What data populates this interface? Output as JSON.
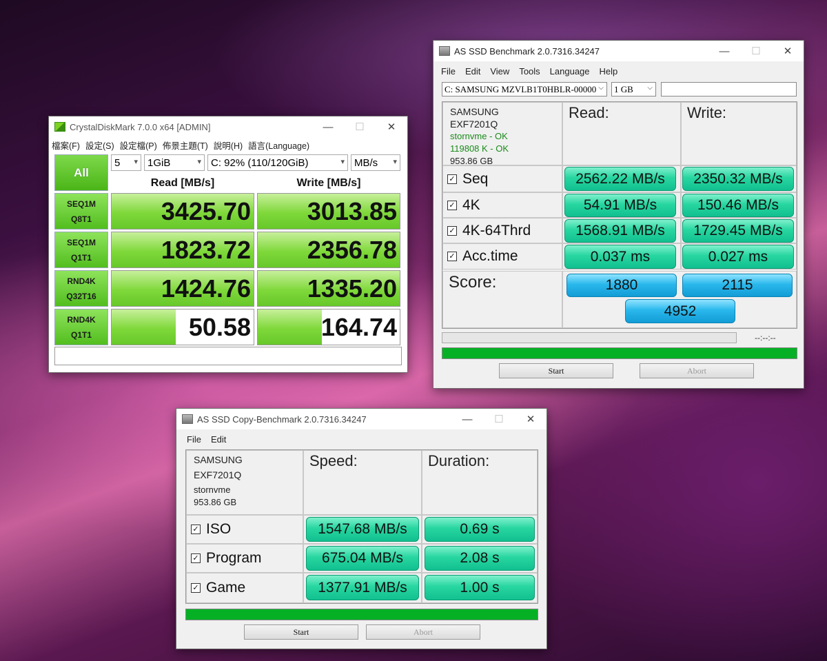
{
  "cdm": {
    "title": "CrystalDiskMark 7.0.0 x64 [ADMIN]",
    "menu": [
      "檔案(F)",
      "設定(S)",
      "設定檔(P)",
      "佈景主題(T)",
      "說明(H)",
      "語言(Language)"
    ],
    "all_label": "All",
    "count": "5",
    "size": "1GiB",
    "drive": "C: 92% (110/120GiB)",
    "unit": "MB/s",
    "read_header": "Read [MB/s]",
    "write_header": "Write [MB/s]",
    "tests": [
      {
        "line1": "SEQ1M",
        "line2": "Q8T1",
        "read": "3425.70",
        "write": "3013.85"
      },
      {
        "line1": "SEQ1M",
        "line2": "Q1T1",
        "read": "1823.72",
        "write": "2356.78"
      },
      {
        "line1": "RND4K",
        "line2": "Q32T16",
        "read": "1424.76",
        "write": "1335.20"
      },
      {
        "line1": "RND4K",
        "line2": "Q1T1",
        "read": "50.58",
        "write": "164.74"
      }
    ],
    "bar_fill_pct": [
      {
        "read": 100,
        "write": 100
      },
      {
        "read": 100,
        "write": 100
      },
      {
        "read": 100,
        "write": 100
      },
      {
        "read": 45,
        "write": 45
      }
    ],
    "status": ""
  },
  "asssd": {
    "title": "AS SSD Benchmark 2.0.7316.34247",
    "menu": [
      "File",
      "Edit",
      "View",
      "Tools",
      "Language",
      "Help"
    ],
    "drive_select": "C: SAMSUNG MZVLB1T0HBLR-00000",
    "size_select": "1 GB",
    "drive_info": [
      "SAMSUNG",
      "EXF7201Q",
      "stornvme - OK",
      "119808 K - OK",
      "953.86 GB"
    ],
    "read_header": "Read:",
    "write_header": "Write:",
    "rows": [
      {
        "label": "Seq",
        "read": "2562.22 MB/s",
        "write": "2350.32 MB/s"
      },
      {
        "label": "4K",
        "read": "54.91 MB/s",
        "write": "150.46 MB/s"
      },
      {
        "label": "4K-64Thrd",
        "read": "1568.91 MB/s",
        "write": "1729.45 MB/s"
      },
      {
        "label": "Acc.time",
        "read": "0.037 ms",
        "write": "0.027 ms"
      }
    ],
    "score_label": "Score:",
    "score_read": "1880",
    "score_write": "2115",
    "score_total": "4952",
    "timer": "--:--:--",
    "start": "Start",
    "abort": "Abort"
  },
  "copy": {
    "title": "AS SSD Copy-Benchmark 2.0.7316.34247",
    "menu": [
      "File",
      "Edit"
    ],
    "drive_info": [
      "SAMSUNG",
      "EXF7201Q",
      "stornvme",
      "953.86 GB"
    ],
    "speed_header": "Speed:",
    "duration_header": "Duration:",
    "rows": [
      {
        "label": "ISO",
        "speed": "1547.68 MB/s",
        "duration": "0.69 s"
      },
      {
        "label": "Program",
        "speed": "675.04 MB/s",
        "duration": "2.08 s"
      },
      {
        "label": "Game",
        "speed": "1377.91 MB/s",
        "duration": "1.00 s"
      }
    ],
    "start": "Start",
    "abort": "Abort"
  },
  "colors": {
    "cdm_green": "#67c82a",
    "asssd_teal": "#12c090",
    "asssd_blue": "#129cd6",
    "progress_green": "#06b025"
  }
}
